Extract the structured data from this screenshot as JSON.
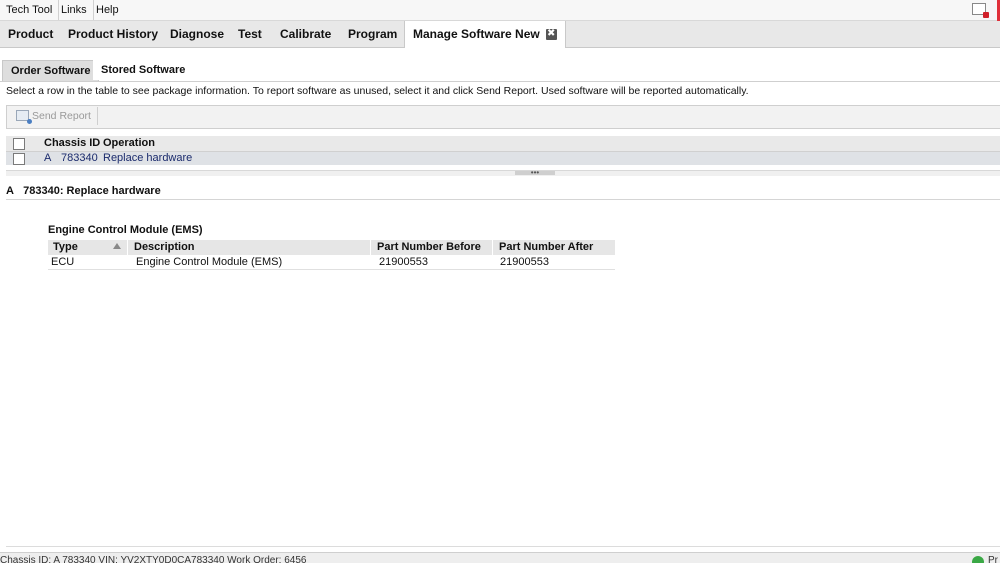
{
  "menu": {
    "items": [
      "Tech Tool",
      "Links",
      "Help"
    ]
  },
  "nav": {
    "tabs": [
      "Product",
      "Product History",
      "Diagnose",
      "Test",
      "Calibrate",
      "Program",
      "Manage Software New"
    ],
    "close_symbol": "✖"
  },
  "subtabs": {
    "order": "Order Software",
    "stored": "Stored Software"
  },
  "instructions": "Select a row in the table to see package information. To report software as unused, select it and click Send Report. Used software will be reported automatically.",
  "toolbar": {
    "send_report_label": "Send Report"
  },
  "table": {
    "headers": {
      "chassis_id": "Chassis ID",
      "operation": "Operation"
    },
    "rows": [
      {
        "series": "A",
        "chassis": "783340",
        "operation": "Replace hardware"
      }
    ]
  },
  "splitter": {
    "grip": "•••"
  },
  "detail": {
    "series": "A",
    "title": "783340: Replace hardware",
    "module_title": "Engine Control Module (EMS)",
    "columns": {
      "type": "Type",
      "description": "Description",
      "part_before": "Part Number Before",
      "part_after": "Part Number After"
    },
    "rows": [
      {
        "type": "ECU",
        "description": "Engine Control Module (EMS)",
        "part_before": "21900553",
        "part_after": "21900553"
      }
    ]
  },
  "status": {
    "text": "Chassis ID: A 783340    VIN: YV2XTY0D0CA783340    Work Order: 6456",
    "indicator_label": "Pr",
    "indicator_color": "#3aa845"
  },
  "colors": {
    "accent_red": "#e0303a",
    "link_blue": "#1a2a6c"
  }
}
